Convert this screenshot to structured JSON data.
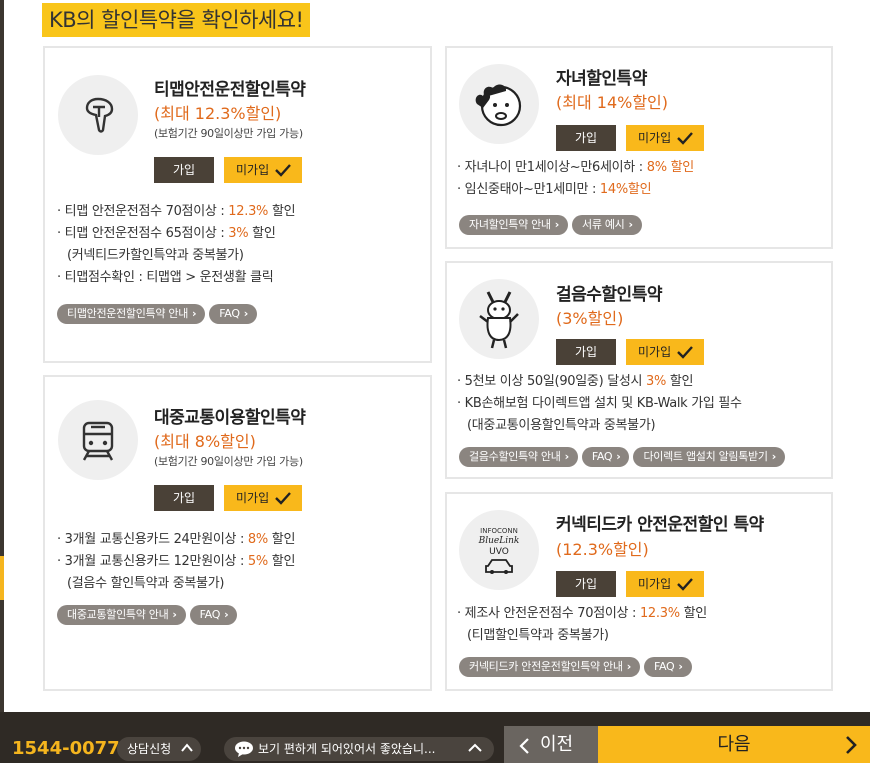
{
  "page_title": "KB의 할인특약을 확인하세요!",
  "join_label": "가입",
  "nojoin_label": "미가입",
  "cards": {
    "tmap": {
      "title": "티맵안전운전할인특약",
      "discount": "(최대 12.3%할인)",
      "note": "(보험기간 90일이상만 가입 가능)",
      "bullets": [
        {
          "pre": "티맵 안전운전점수 70점이상 : ",
          "hl": "12.3%",
          "post": " 할인"
        },
        {
          "pre": "티맵 안전운전점수 65점이상 : ",
          "hl": "3%",
          "post": " 할인"
        },
        {
          "cont": "(커넥티드카할인특약과 중복불가)"
        },
        {
          "pre": "티맵점수확인 : 티맵앱 > 운전생활 클릭"
        }
      ],
      "links": [
        "티맵안전운전할인특약 안내",
        "FAQ"
      ]
    },
    "child": {
      "title": "자녀할인특약",
      "discount": "(최대 14%할인)",
      "bullets": [
        {
          "pre": "자녀나이 만1세이상~만6세이하 : ",
          "hl": "8% 할인"
        },
        {
          "pre": "임신중태아~만1세미만 : ",
          "hl": "14%할인"
        }
      ],
      "links": [
        "자녀할인특약 안내",
        "서류 예시"
      ]
    },
    "walk": {
      "title": "걸음수할인특약",
      "discount": "(3%할인)",
      "bullets": [
        {
          "pre": "5천보 이상 50일(90일중) 달성시 ",
          "hl": "3%",
          "post": " 할인"
        },
        {
          "pre": "KB손해보험 다이렉트앱 설치 및 KB-Walk 가입 필수"
        },
        {
          "cont": "(대중교통이용할인특약과 중복불가)"
        }
      ],
      "links": [
        "걸음수할인특약 안내",
        "FAQ",
        "다이렉트 앱설치 알림톡받기"
      ]
    },
    "transit": {
      "title": "대중교통이용할인특약",
      "discount": "(최대 8%할인)",
      "note": "(보험기간 90일이상만 가입 가능)",
      "bullets": [
        {
          "pre": "3개월 교통신용카드 24만원이상 : ",
          "hl": "8%",
          "post": " 할인"
        },
        {
          "pre": "3개월 교통신용카드 12만원이상 : ",
          "hl": "5%",
          "post": " 할인"
        },
        {
          "cont": "(걸음수 할인특약과 중복불가)"
        }
      ],
      "links": [
        "대중교통할인특약 안내",
        "FAQ"
      ]
    },
    "connected": {
      "title": "커넥티드카 안전운전할인 특약",
      "discount": "(12.3%할인)",
      "logo_text": [
        "INFOCONN",
        "BlueLink",
        "UVO"
      ],
      "bullets": [
        {
          "pre": "제조사 안전운전점수 70점이상 : ",
          "hl": "12.3%",
          "post": " 할인"
        },
        {
          "cont": "(티맵할인특약과 중복불가)"
        }
      ],
      "links": [
        "커넥티드카 안전운전할인특약 안내",
        "FAQ"
      ]
    }
  },
  "footer": {
    "phone": "1544-0077",
    "consult": "상담신청",
    "chat": "보기 편하게 되어있어서 좋았습니...",
    "prev": "이전",
    "next": "다음"
  },
  "colors": {
    "accent": "#f9b81b",
    "highlight": "#e06a1c",
    "dark": "#4a4137"
  }
}
